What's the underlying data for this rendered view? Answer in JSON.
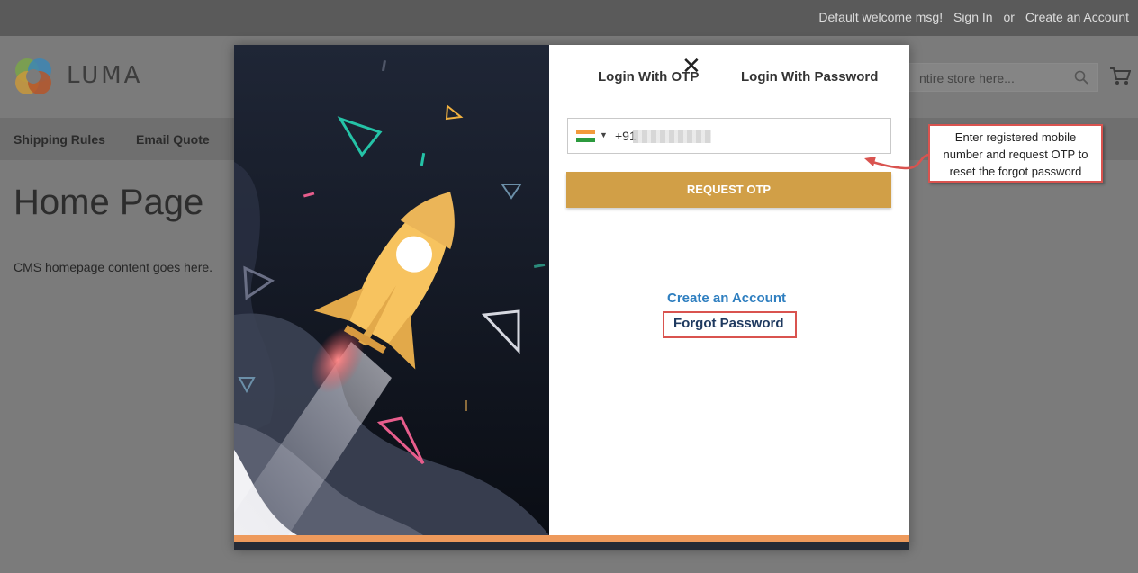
{
  "header": {
    "welcome": "Default welcome msg!",
    "sign_in": "Sign In",
    "or": "or",
    "create_account": "Create an Account"
  },
  "store": {
    "logo_text": "LUMA",
    "search_placeholder": "ntire store here...",
    "nav": [
      "Shipping Rules",
      "Email Quote"
    ],
    "page_title": "Home Page",
    "cms_text": "CMS homepage content goes here."
  },
  "modal": {
    "tabs": [
      "Login With OTP",
      "Login With Password"
    ],
    "close_glyph": "✕",
    "dial_code": "+91",
    "request_otp": "REQUEST OTP",
    "create_account": "Create an Account",
    "forgot_password": "Forgot Password"
  },
  "callout": {
    "line1": "Enter registered mobile",
    "line2": "number and request OTP to",
    "line3": "reset the forgot password"
  },
  "colors": {
    "accent_button": "#d19f47",
    "link_blue": "#2f7fc0",
    "annotation_red": "#d9534f"
  }
}
